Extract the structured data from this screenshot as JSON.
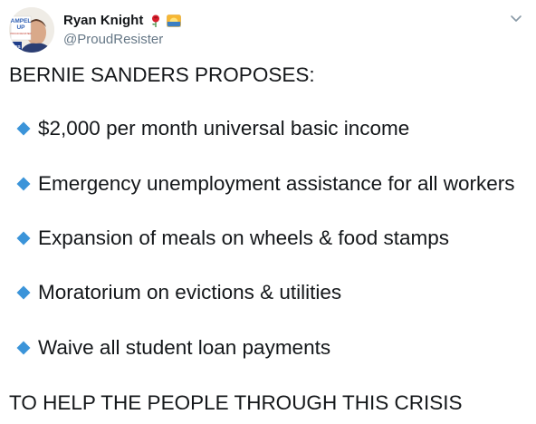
{
  "author": {
    "display_name": "Ryan Knight",
    "handle": "@ProudResister",
    "avatar_text_top": "AMPEL",
    "avatar_text_mid": "UP",
    "avatar_text_small": "PROUD RESISTER",
    "avatar_text_side": "RES"
  },
  "tweet": {
    "headline": "BERNIE SANDERS PROPOSES:",
    "bullets": [
      "$2,000 per month universal basic income",
      "Emergency unemployment assistance for all workers",
      "Expansion of meals on wheels & food stamps",
      "Moratorium on evictions & utilities",
      "Waive all student loan payments"
    ],
    "closing": "TO HELP THE PEOPLE THROUGH THIS CRISIS"
  },
  "icons": {
    "rose": "rose-emoji-icon",
    "sunrise": "sunrise-emoji-icon",
    "bullet": "blue-diamond-icon",
    "menu": "chevron-down-icon"
  },
  "colors": {
    "text": "#14171a",
    "secondary": "#657786",
    "diamond": "#3b94d9",
    "chevron": "#8899a6"
  }
}
